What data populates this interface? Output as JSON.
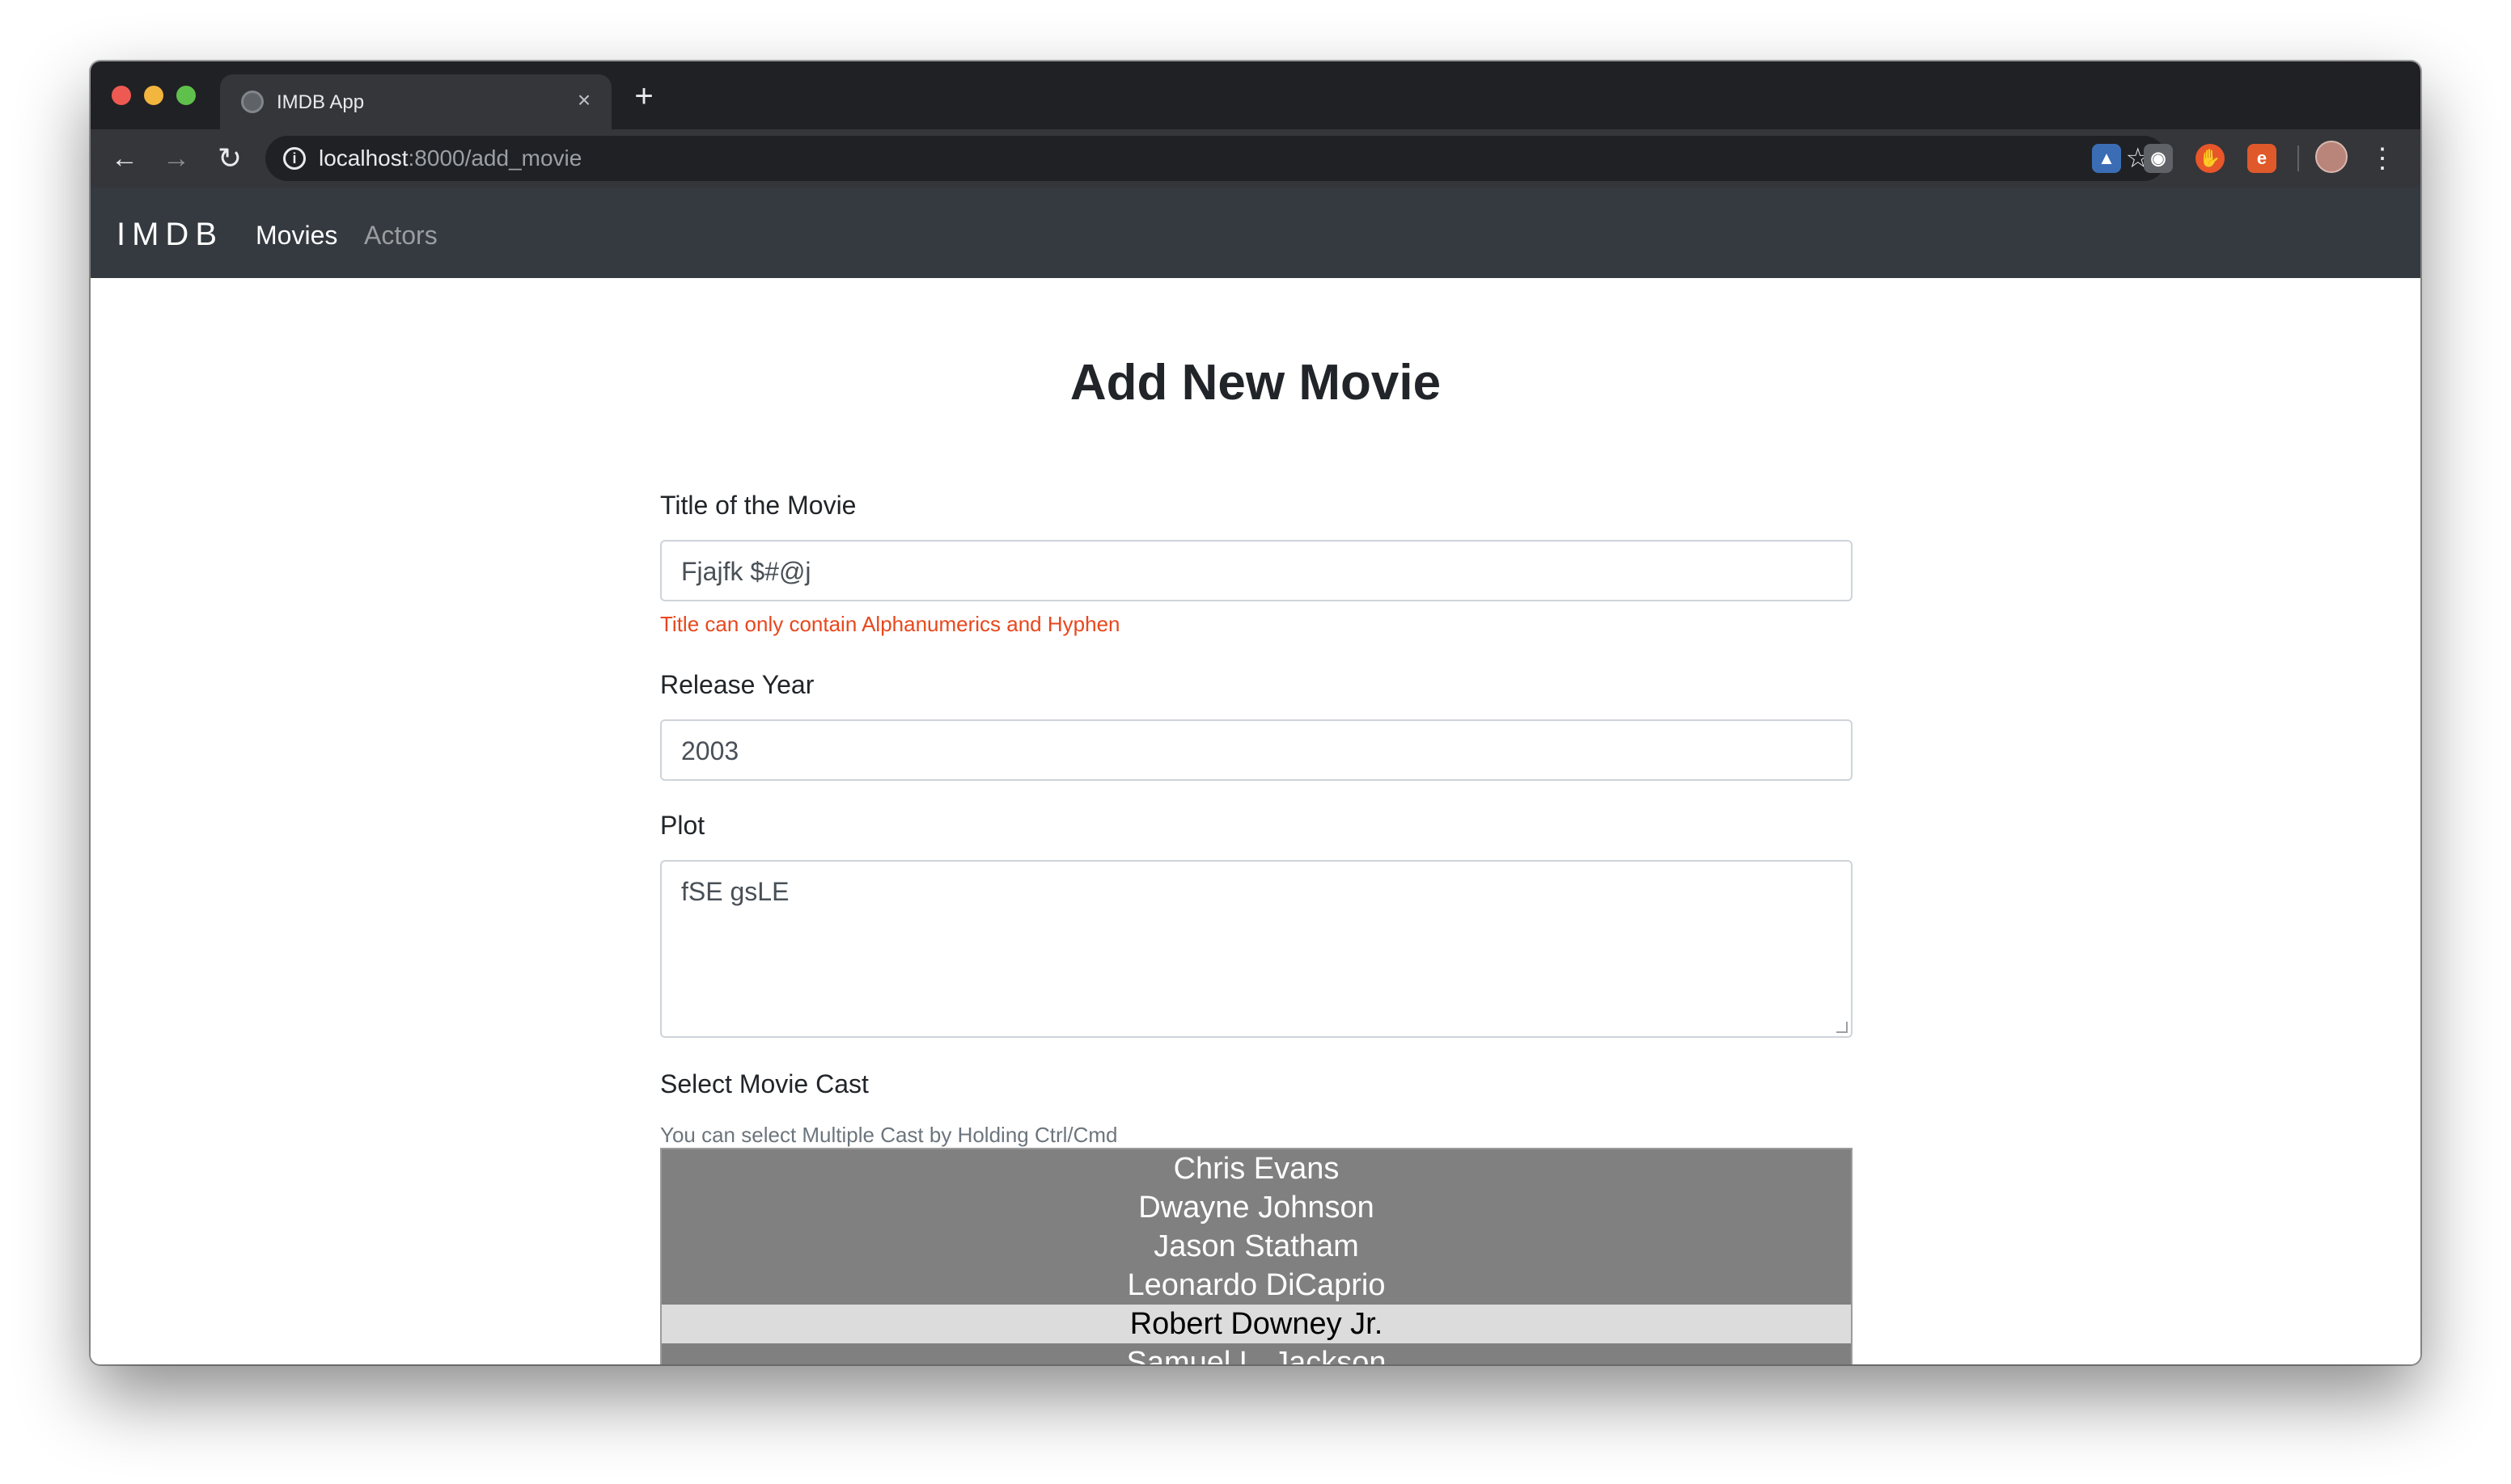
{
  "browser": {
    "tab_title": "IMDB App",
    "tab_close": "×",
    "new_tab": "+",
    "url_host": "localhost",
    "url_rest": ":8000/add_movie"
  },
  "navbar": {
    "brand": "IMDB",
    "links": [
      "Movies",
      "Actors"
    ]
  },
  "form": {
    "heading": "Add New Movie",
    "title_label": "Title of the Movie",
    "title_value": "Fjajfk $#@j",
    "title_error": "Title can only contain Alphanumerics and Hyphen",
    "year_label": "Release Year",
    "year_value": "2003",
    "plot_label": "Plot",
    "plot_value": "fSE gsLE",
    "cast_label": "Select Movie Cast",
    "cast_help": "You can select Multiple Cast by Holding Ctrl/Cmd",
    "cast_options": [
      "Chris Evans",
      "Dwayne Johnson",
      "Jason Statham",
      "Leonardo DiCaprio",
      "Robert Downey Jr.",
      "Samuel L. Jackson"
    ],
    "cast_selected": "Robert Downey Jr."
  },
  "colors": {
    "navbar_bg": "#343a40",
    "error": "#e8471d",
    "select_bg": "#808080",
    "selected_option_bg": "#dcdcdc"
  }
}
